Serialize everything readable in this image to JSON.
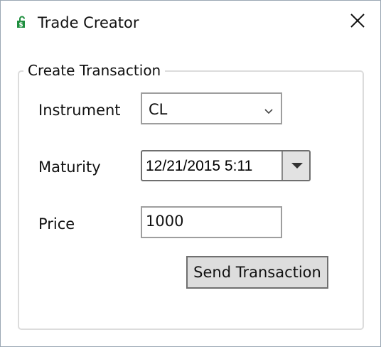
{
  "window": {
    "title": "Trade Creator",
    "app_icon": "dollar-lock-icon",
    "close_icon": "close-icon"
  },
  "group": {
    "legend": "Create Transaction"
  },
  "form": {
    "instrument": {
      "label": "Instrument",
      "value": "CL"
    },
    "maturity": {
      "label": "Maturity",
      "value": "12/21/2015 5:11"
    },
    "price": {
      "label": "Price",
      "value": "1000"
    },
    "submit_label": "Send Transaction"
  },
  "colors": {
    "icon_green": "#1e8e3e",
    "button_face": "#dddddd",
    "border": "#9e9e9e"
  }
}
